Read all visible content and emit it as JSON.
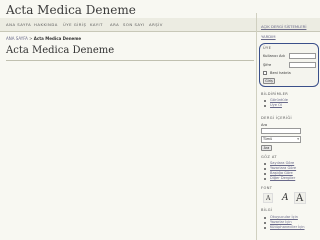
{
  "site": {
    "title": "Acta Medica Deneme"
  },
  "nav": {
    "items": [
      {
        "label": "ANA SAYFA"
      },
      {
        "label": "HAKKINDA"
      },
      {
        "label": "ÜYE GİRİŞ"
      },
      {
        "label": "KAYIT"
      },
      {
        "label": "ARA"
      },
      {
        "label": "SON SAYI"
      },
      {
        "label": "ARŞİV"
      }
    ]
  },
  "breadcrumb": {
    "home": "ANA SAYFA",
    "separator": " > ",
    "current": "Acta Medica Deneme"
  },
  "main": {
    "title": "Acta Medica Deneme"
  },
  "sidebar": {
    "top_links": [
      "AÇIK DERGİ SİSTEMLERİ",
      "YARDIM"
    ],
    "user": {
      "heading": "ÜYE",
      "username_label": "Kullanıcı Adı",
      "password_label": "Şifre",
      "remember_label": "Beni hatırla",
      "login_button": "Giriş"
    },
    "notifications": {
      "heading": "BİLDİRİMLER",
      "items": [
        "Görüntüle",
        "Üye Ol"
      ]
    },
    "search": {
      "heading": "DERGİ İÇERİĞİ",
      "ara_label": "Ara",
      "scope_selected": "Tümü",
      "search_button": "Ara",
      "browse_heading": "GÖZ AT",
      "browse_items": [
        "Sayılara Göre",
        "Yazarlara Göre",
        "Başlığa Göre",
        "Diğer Dergiler"
      ]
    },
    "font": {
      "heading": "FONT",
      "small": "A",
      "medium": "A",
      "large": "A"
    },
    "info": {
      "heading": "BİLGİ",
      "items": [
        "Okuyucular İçin",
        "Yazarlar İçin",
        "Kütüphaneciler İçin"
      ]
    }
  }
}
